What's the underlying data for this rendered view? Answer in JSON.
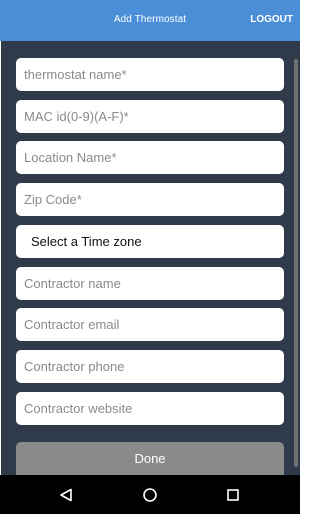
{
  "header": {
    "title": "Add Thermostat",
    "logout_label": "LOGOUT"
  },
  "form": {
    "thermostat_name": {
      "value": "",
      "placeholder": "thermostat name*"
    },
    "mac_id": {
      "value": "",
      "placeholder": "MAC id(0-9)(A-F)*"
    },
    "location_name": {
      "value": "",
      "placeholder": "Location Name*"
    },
    "zip_code": {
      "value": "",
      "placeholder": "Zip Code*"
    },
    "time_zone": {
      "selected": "Select a Time zone"
    },
    "contractor_name": {
      "value": "",
      "placeholder": "Contractor name"
    },
    "contractor_email": {
      "value": "",
      "placeholder": "Contractor email"
    },
    "contractor_phone": {
      "value": "",
      "placeholder": "Contractor phone"
    },
    "contractor_website": {
      "value": "",
      "placeholder": "Contractor website"
    },
    "done_label": "Done"
  },
  "nav": {
    "back_icon": "back-triangle-icon",
    "home_icon": "home-circle-icon",
    "recents_icon": "recents-square-icon"
  },
  "colors": {
    "header_bg": "#4a8ed8",
    "content_bg": "#2f3a4b",
    "done_bg": "#8a8a8a",
    "navbar_bg": "#000000"
  }
}
